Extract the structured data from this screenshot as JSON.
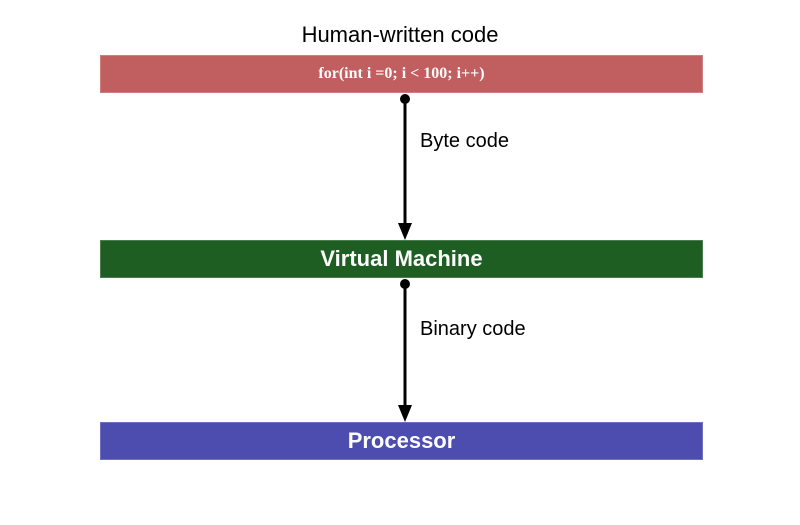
{
  "diagram": {
    "title": "Human-written code",
    "box_code": "for(int i =0; i < 100; i++)",
    "arrow1_label": "Byte code",
    "box_vm": "Virtual Machine",
    "arrow2_label": "Binary code",
    "box_proc": "Processor"
  }
}
